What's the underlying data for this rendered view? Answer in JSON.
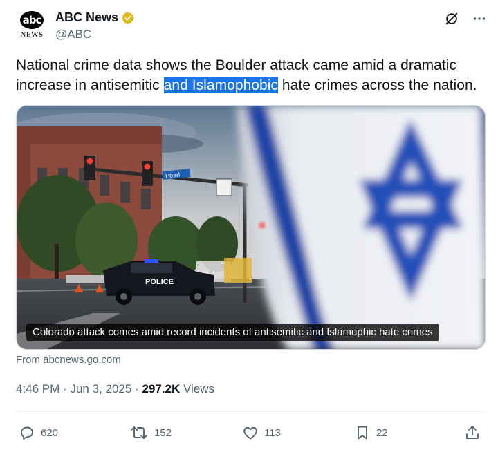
{
  "author": {
    "display_name": "ABC News",
    "handle": "@ABC",
    "logo_text": "abc",
    "logo_subtext": "NEWS",
    "verified_color": "#e2b719"
  },
  "top_icons": [
    "grok-icon",
    "more-icon"
  ],
  "tweet": {
    "text_before": "National crime data shows the Boulder attack came amid a dramatic increase in antisemitic ",
    "text_highlighted": "and Islamophobic",
    "text_after": " hate crimes across the nation.",
    "highlight_color": "#1a73e8"
  },
  "media": {
    "caption": "Colorado attack comes amid record incidents of antisemitic and Islamophic hate crimes",
    "street_sign": "Pearl",
    "police_label": "POLICE"
  },
  "link_source": "From abcnews.go.com",
  "meta": {
    "time": "4:46 PM",
    "separator": "·",
    "date": "Jun 3, 2025",
    "views_count": "297.2K",
    "views_label": "Views"
  },
  "actions": {
    "replies": "620",
    "reposts": "152",
    "likes": "113",
    "bookmarks": "22"
  }
}
